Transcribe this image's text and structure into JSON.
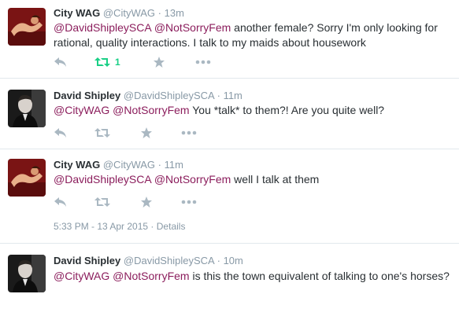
{
  "tweets": [
    {
      "name": "City WAG",
      "handle": "@CityWAG",
      "sep": "·",
      "time": "13m",
      "m1": "@DavidShipleySCA",
      "m2": "@NotSorryFem",
      "text": "another female? Sorry I'm only looking for rational, quality interactions. I talk to my maids about housework",
      "retweet_count": "1"
    },
    {
      "name": "David Shipley",
      "handle": "@DavidShipleySCA",
      "sep": "·",
      "time": "11m",
      "m1": "@CityWAG",
      "m2": "@NotSorryFem",
      "text": "You *talk* to them?! Are you quite well?"
    },
    {
      "name": "City WAG",
      "handle": "@CityWAG",
      "sep": "·",
      "time": "11m",
      "m1": "@DavidShipleySCA",
      "m2": "@NotSorryFem",
      "text": "well I talk at them",
      "timestamp": "5:33 PM - 13 Apr 2015",
      "meta_sep": "·",
      "details": "Details"
    },
    {
      "name": "David Shipley",
      "handle": "@DavidShipleySCA",
      "sep": "·",
      "time": "10m",
      "m1": "@CityWAG",
      "m2": "@NotSorryFem",
      "text": "is this the town equivalent of talking to one's horses?"
    }
  ],
  "colors": {
    "mention": "#8b1d5c",
    "retweet_active": "#19cf86",
    "icon_gray": "#aab8c2",
    "muted": "#8899a6"
  },
  "icons": [
    "reply-icon",
    "retweet-icon",
    "favorite-icon",
    "more-icon"
  ]
}
